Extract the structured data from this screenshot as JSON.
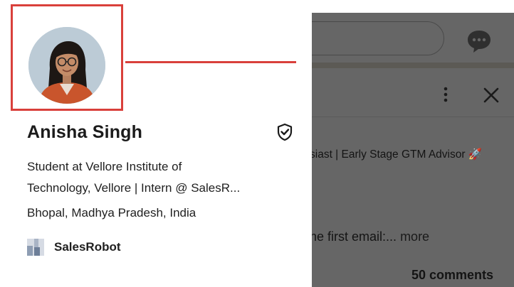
{
  "profile": {
    "name": "Anisha Singh",
    "headline_line1": "Student at Vellore Institute of",
    "headline_line2": "Technology, Vellore | Intern @ SalesR...",
    "location": "Bhopal, Madhya Pradesh, India",
    "company": "SalesRobot",
    "avatar_icon": "profile-photo",
    "verified_icon": "shield-check-icon"
  },
  "background_feed": {
    "headline_fragment": "siast | Early Stage GTM Advisor 🚀",
    "excerpt_fragment": "he first email:...",
    "more_link": "more",
    "comments": "50 comments",
    "icons": [
      "chat-icon",
      "more-vertical-icon",
      "close-icon"
    ]
  },
  "colors": {
    "highlight": "#d9403b",
    "overlay": "#666666"
  }
}
